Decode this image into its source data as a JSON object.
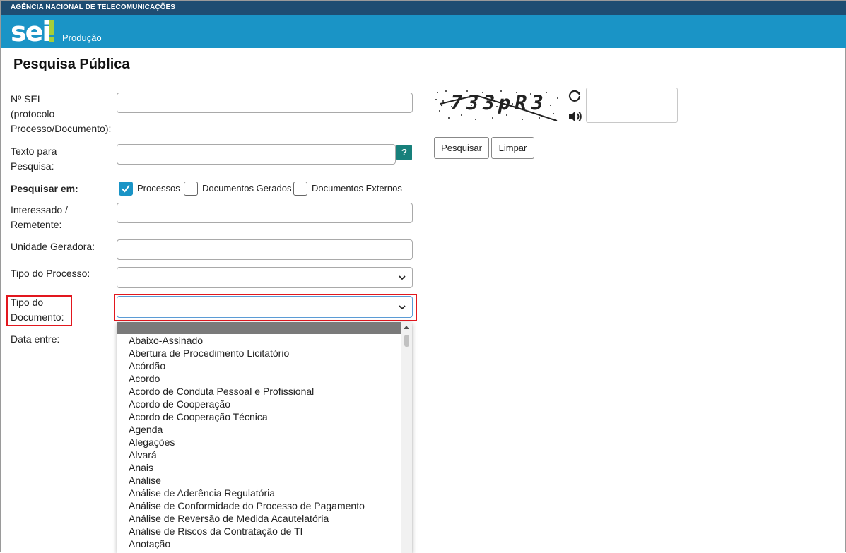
{
  "header": {
    "agency": "AGÊNCIA NACIONAL DE TELECOMUNICAÇÕES",
    "logo_text": "sei",
    "environment": "Produção"
  },
  "page": {
    "title": "Pesquisa Pública"
  },
  "form": {
    "protocol_label": [
      "Nº SEI",
      "(protocolo",
      "Processo/Documento):"
    ],
    "protocol_value": "",
    "text_label": [
      "Texto para",
      "Pesquisa:"
    ],
    "text_value": "",
    "help_label": "?",
    "search_in_label": "Pesquisar em:",
    "search_in_options": [
      {
        "label": "Processos",
        "checked": true
      },
      {
        "label": "Documentos Gerados",
        "checked": false
      },
      {
        "label": "Documentos Externos",
        "checked": false
      }
    ],
    "interested_label": [
      "Interessado /",
      "Remetente:"
    ],
    "interested_value": "",
    "unit_label": "Unidade Geradora:",
    "unit_value": "",
    "process_type_label": "Tipo do Processo:",
    "process_type_value": "",
    "document_type_label": [
      "Tipo do",
      "Documento:"
    ],
    "document_type_value": "",
    "date_label": "Data entre:"
  },
  "document_type_options": [
    "",
    "Abaixo-Assinado",
    "Abertura de Procedimento Licitatório",
    "Acórdão",
    "Acordo",
    "Acordo de Conduta Pessoal e Profissional",
    "Acordo de Cooperação",
    "Acordo de Cooperação Técnica",
    "Agenda",
    "Alegações",
    "Alvará",
    "Anais",
    "Análise",
    "Análise de Aderência Regulatória",
    "Análise de Conformidade do Processo de Pagamento",
    "Análise de Reversão de Medida Acautelatória",
    "Análise de Riscos da Contratação de TI",
    "Anotação"
  ],
  "captcha": {
    "code": "733pR3",
    "answer": ""
  },
  "buttons": {
    "search": "Pesquisar",
    "clear": "Limpar"
  },
  "colors": {
    "topbar": "#1e4d72",
    "brandbar": "#1a94c6",
    "accent": "#1a94c6",
    "highlight": "#e2171e",
    "logo_mark": "#a6ce39"
  }
}
